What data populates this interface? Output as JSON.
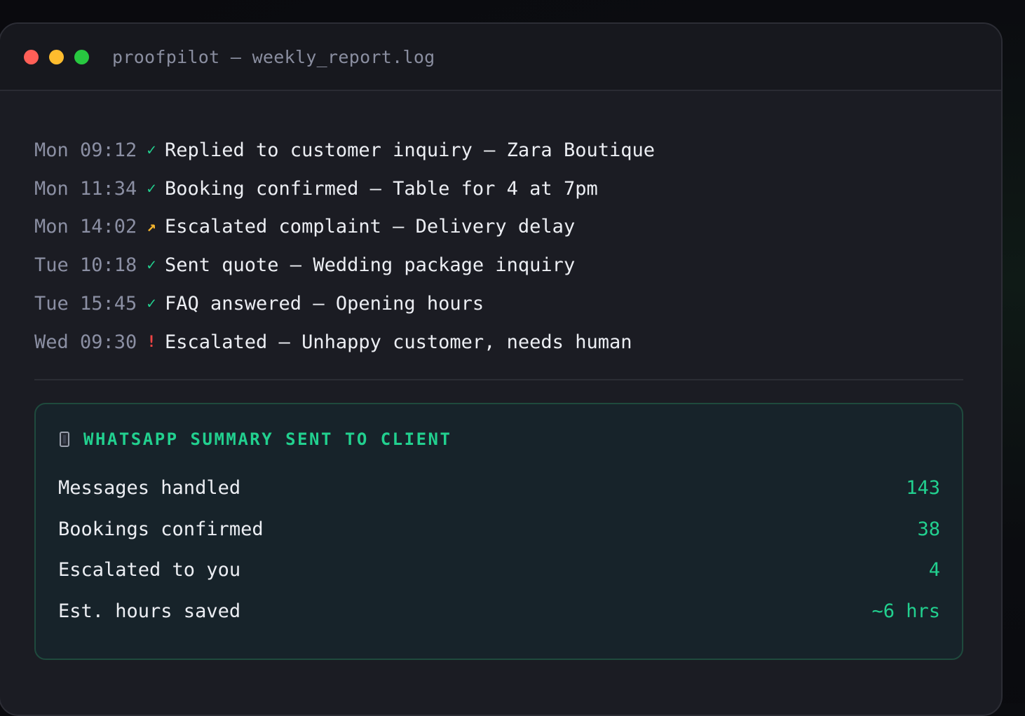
{
  "window": {
    "title": "proofpilot — weekly_report.log",
    "controls": [
      "close",
      "minimize",
      "maximize"
    ]
  },
  "log": [
    {
      "timestamp": "Mon 09:12",
      "mark": "✓",
      "mark_color": "#22d08f",
      "message": "Replied to customer inquiry — Zara Boutique"
    },
    {
      "timestamp": "Mon 11:34",
      "mark": "✓",
      "mark_color": "#22d08f",
      "message": "Booking confirmed — Table for 4 at 7pm"
    },
    {
      "timestamp": "Mon 14:02",
      "mark": "↗",
      "mark_color": "#f5b52e",
      "message": "Escalated complaint — Delivery delay"
    },
    {
      "timestamp": "Tue 10:18",
      "mark": "✓",
      "mark_color": "#22d08f",
      "message": "Sent quote — Wedding package inquiry"
    },
    {
      "timestamp": "Tue 15:45",
      "mark": "✓",
      "mark_color": "#22d08f",
      "message": "FAQ answered — Opening hours"
    },
    {
      "timestamp": "Wed 09:30",
      "mark": "!",
      "mark_color": "#ef4444",
      "message": "Escalated — Unhappy customer, needs human"
    }
  ],
  "summary": {
    "icon": "mobile-phone-icon",
    "title": "WHATSAPP SUMMARY SENT TO CLIENT",
    "stats": [
      {
        "label": "Messages handled",
        "value": "143"
      },
      {
        "label": "Bookings confirmed",
        "value": "38"
      },
      {
        "label": "Escalated to you",
        "value": "4"
      },
      {
        "label": "Est. hours saved",
        "value": "~6 hrs"
      }
    ]
  },
  "colors": {
    "accent": "#22d08f",
    "warning": "#f5b52e",
    "error": "#ef4444",
    "window_bg": "#1b1c23",
    "summary_bg": "#17232a"
  }
}
